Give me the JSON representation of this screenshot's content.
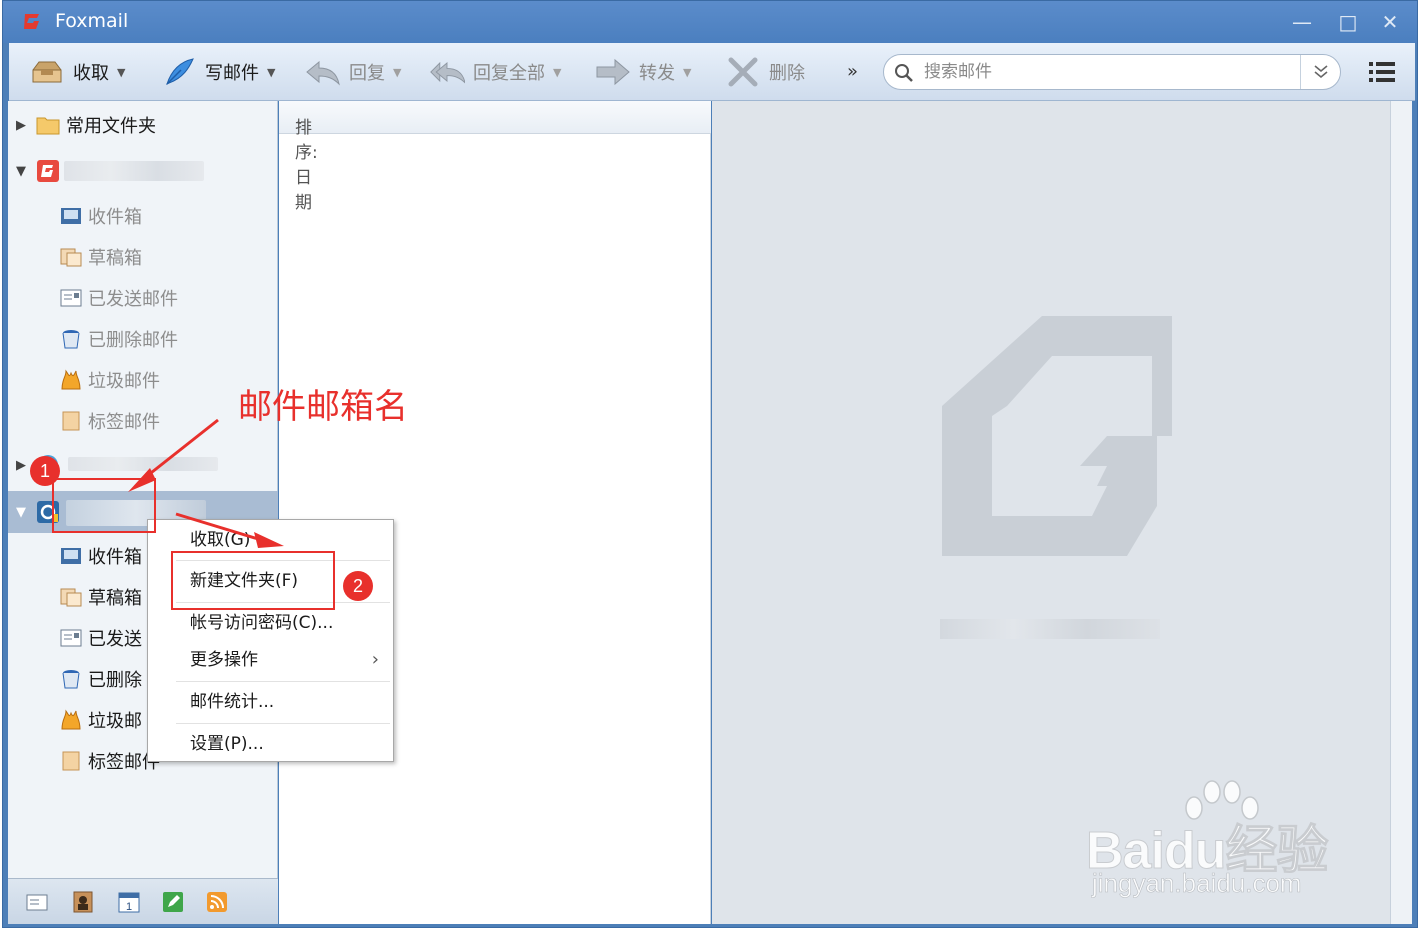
{
  "window": {
    "title": "Foxmail"
  },
  "toolbar": {
    "receive": "收取",
    "compose": "写邮件",
    "reply": "回复",
    "reply_all": "回复全部",
    "forward": "转发",
    "delete": "删除",
    "more": "»",
    "search_placeholder": "搜索邮件"
  },
  "sidebar": {
    "common_folders": "常用文件夹",
    "account1_folders": [
      {
        "label": "收件箱",
        "icon": "inbox-icon"
      },
      {
        "label": "草稿箱",
        "icon": "drafts-icon"
      },
      {
        "label": "已发送邮件",
        "icon": "sent-icon"
      },
      {
        "label": "已删除邮件",
        "icon": "trash-icon"
      },
      {
        "label": "垃圾邮件",
        "icon": "junk-icon"
      },
      {
        "label": "标签邮件",
        "icon": "tag-icon"
      }
    ],
    "account3_folders": [
      {
        "label": "收件箱"
      },
      {
        "label": "草稿箱"
      },
      {
        "label": "已发送"
      },
      {
        "label": "已删除"
      },
      {
        "label": "垃圾邮"
      },
      {
        "label": "标签邮件"
      }
    ]
  },
  "listpane": {
    "sort_label": "排序:日期"
  },
  "context_menu": {
    "items": [
      "收取(G)",
      "新建文件夹(F)",
      "帐号访问密码(C)...",
      "更多操作",
      "邮件统计...",
      "设置(P)..."
    ]
  },
  "annotations": {
    "text": "邮件邮箱名",
    "badge1": "1",
    "badge2": "2",
    "color": "#e8302c"
  },
  "watermark": {
    "brand": "Baidu经验",
    "domain": "jingyan.baidu.com"
  }
}
